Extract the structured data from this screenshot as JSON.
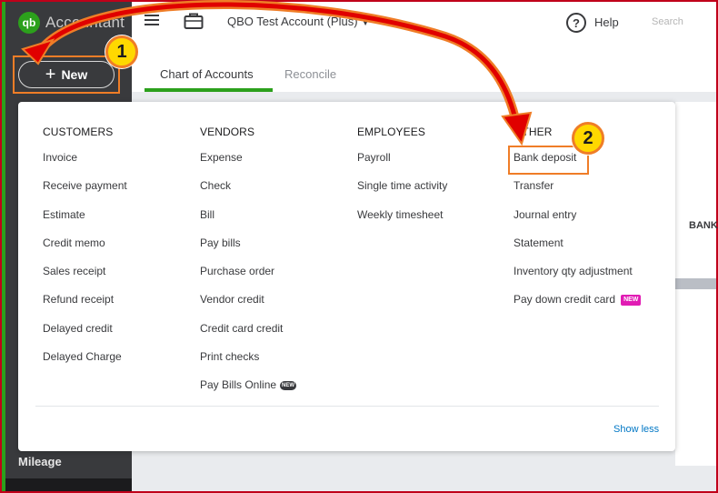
{
  "app": {
    "logo_text": "Accountant",
    "logo_mark": "qb",
    "account_name": "QBO Test Account (Plus)",
    "help_label": "Help",
    "search_label": "Search"
  },
  "sidebar": {
    "new_button_label": "New",
    "bottom_item": "Mileage"
  },
  "tabs": {
    "active": "Chart of Accounts",
    "inactive": "Reconcile"
  },
  "background": {
    "column_header": "BANK"
  },
  "menu": {
    "columns": [
      {
        "heading": "CUSTOMERS",
        "items": [
          "Invoice",
          "Receive payment",
          "Estimate",
          "Credit memo",
          "Sales receipt",
          "Refund receipt",
          "Delayed credit",
          "Delayed Charge"
        ]
      },
      {
        "heading": "VENDORS",
        "items": [
          "Expense",
          "Check",
          "Bill",
          "Pay bills",
          "Purchase order",
          "Vendor credit",
          "Credit card credit",
          "Print checks",
          "Pay Bills Online"
        ]
      },
      {
        "heading": "EMPLOYEES",
        "items": [
          "Payroll",
          "Single time activity",
          "Weekly timesheet"
        ]
      },
      {
        "heading": "OTHER",
        "items": [
          "Bank deposit",
          "Transfer",
          "Journal entry",
          "Statement",
          "Inventory qty adjustment",
          "Pay down credit card"
        ]
      }
    ],
    "badges": {
      "pay_bills_online": "NEW",
      "pay_down_credit_card": "NEW"
    },
    "show_less_label": "Show less"
  },
  "annotations": {
    "step1": "1",
    "step2": "2",
    "highlight_color": "#ef7d27",
    "arrow_color": "#e00000",
    "marker_fill": "#ffd800"
  }
}
